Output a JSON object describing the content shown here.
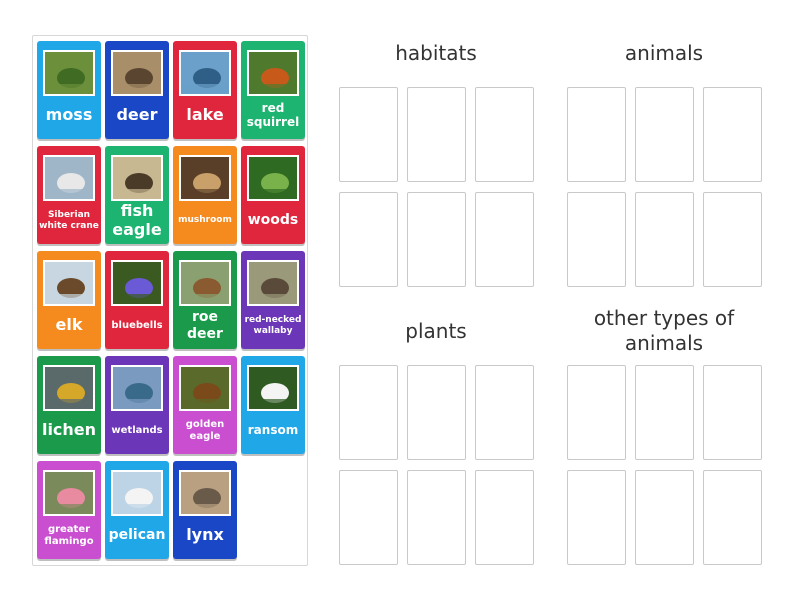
{
  "cards": [
    {
      "id": "moss",
      "label": "moss",
      "color": "#1fa7e8",
      "icon": "moss-photo",
      "size": "s-xl"
    },
    {
      "id": "deer",
      "label": "deer",
      "color": "#1a47c5",
      "icon": "deer-photo",
      "size": "s-xl"
    },
    {
      "id": "lake",
      "label": "lake",
      "color": "#e0263c",
      "icon": "lake-photo",
      "size": "s-xl"
    },
    {
      "id": "red-squirrel",
      "label": "red squirrel",
      "color": "#1db371",
      "icon": "red-squirrel-photo",
      "size": "s-m"
    },
    {
      "id": "siberian-white-crane",
      "label": "Siberian white crane",
      "color": "#e0263c",
      "icon": "crane-photo",
      "size": "s-xs"
    },
    {
      "id": "fish-eagle",
      "label": "fish eagle",
      "color": "#1db371",
      "icon": "fish-eagle-photo",
      "size": "s-xl"
    },
    {
      "id": "mushroom",
      "label": "mushroom",
      "color": "#f58a1f",
      "icon": "mushroom-photo",
      "size": "s-xs"
    },
    {
      "id": "woods",
      "label": "woods",
      "color": "#e0263c",
      "icon": "woods-photo",
      "size": "s-l"
    },
    {
      "id": "elk",
      "label": "elk",
      "color": "#f58a1f",
      "icon": "elk-photo",
      "size": "s-xl"
    },
    {
      "id": "bluebells",
      "label": "bluebells",
      "color": "#e0263c",
      "icon": "bluebells-photo",
      "size": "s-s"
    },
    {
      "id": "roe-deer",
      "label": "roe deer",
      "color": "#1a9a4a",
      "icon": "roe-deer-photo",
      "size": "s-l"
    },
    {
      "id": "red-necked-wallaby",
      "label": "red-necked wallaby",
      "color": "#6c36b8",
      "icon": "wallaby-photo",
      "size": "s-xs"
    },
    {
      "id": "lichen",
      "label": "lichen",
      "color": "#1a9a4a",
      "icon": "lichen-photo",
      "size": "s-xl"
    },
    {
      "id": "wetlands",
      "label": "wetlands",
      "color": "#6c36b8",
      "icon": "wetlands-photo",
      "size": "s-s"
    },
    {
      "id": "golden-eagle",
      "label": "golden eagle",
      "color": "#c94fd0",
      "icon": "golden-eagle-photo",
      "size": "s-s"
    },
    {
      "id": "ransom",
      "label": "ransom",
      "color": "#1fa7e8",
      "icon": "ransom-photo",
      "size": "s-m"
    },
    {
      "id": "greater-flamingo",
      "label": "greater flamingo",
      "color": "#c94fd0",
      "icon": "flamingo-photo",
      "size": "s-s"
    },
    {
      "id": "pelican",
      "label": "pelican",
      "color": "#1fa7e8",
      "icon": "pelican-photo",
      "size": "s-l"
    },
    {
      "id": "lynx",
      "label": "lynx",
      "color": "#1a47c5",
      "icon": "lynx-photo",
      "size": "s-xl"
    }
  ],
  "groups": [
    {
      "id": "habitats",
      "title": "habitats"
    },
    {
      "id": "animals",
      "title": "animals"
    },
    {
      "id": "plants",
      "title": "plants"
    },
    {
      "id": "other-types-of-animals",
      "title": "other types of animals"
    }
  ]
}
